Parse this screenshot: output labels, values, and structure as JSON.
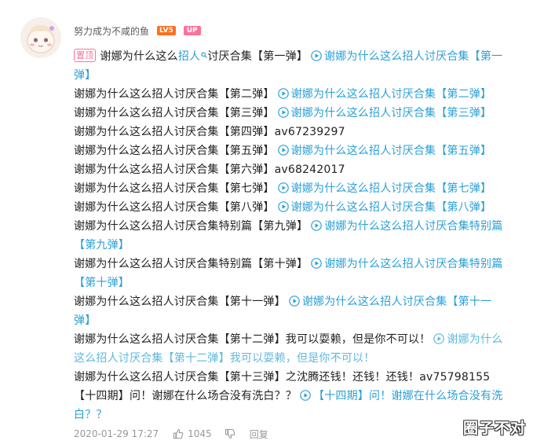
{
  "comment": {
    "username": "努力成为不咸的鱼",
    "level_badge": "LV5",
    "up_badge": "UP",
    "pin_label": "置顶",
    "keyword": "招人",
    "lines": [
      [
        "谢娜为什么这么",
        "讨厌合集【第一弹】",
        "谢娜为什么这么招人讨厌合集【第一",
        "弹】"
      ],
      [
        "谢娜为什么这么招人讨厌合集【第二弹】",
        "谢娜为什么这么招人讨厌合集【第二弹】"
      ],
      [
        "谢娜为什么这么招人讨厌合集【第三弹】",
        "谢娜为什么这么招人讨厌合集【第三弹】"
      ],
      [
        "谢娜为什么这么招人讨厌合集【第四弹】av67239297"
      ],
      [
        "谢娜为什么这么招人讨厌合集【第五弹】",
        "谢娜为什么这么招人讨厌合集【第五弹】"
      ],
      [
        "谢娜为什么这么招人讨厌合集【第六弹】av68242017"
      ],
      [
        "谢娜为什么这么招人讨厌合集【第七弹】",
        "谢娜为什么这么招人讨厌合集【第七弹】"
      ],
      [
        "谢娜为什么这么招人讨厌合集【第八弹】",
        "谢娜为什么这么招人讨厌合集【第八弹】"
      ],
      [
        "谢娜为什么这么招人讨厌合集特别篇【第九弹】",
        "谢娜为什么这么招人讨厌合集特别篇",
        "【第九弹】"
      ],
      [
        "谢娜为什么这么招人讨厌合集特别篇【第十弹】",
        "谢娜为什么这么招人讨厌合集特别篇",
        "【第十弹】"
      ],
      [
        "谢娜为什么这么招人讨厌合集【第十一弹】",
        "谢娜为什么这么招人讨厌合集【第十一",
        "弹】"
      ],
      [
        "谢娜为什么这么招人讨厌合集【第十二弹】我可以耍赖，但是你不可以！",
        "谢娜为什么",
        "这么招人讨厌合集【第十二弹】我可以耍赖，但是你不可以！"
      ],
      [
        "谢娜为什么这么招人讨厌合集【第十三弹】之沈腾还钱！还钱！还钱！av75798155"
      ],
      [
        "【十四期】问！谢娜在什么场合没有洗白？？",
        "【十四期】问！谢娜在什么场合没有洗",
        "白？？"
      ]
    ],
    "timestamp": "2020-01-29 17:27",
    "like_count": "1045",
    "reply_label": "回复"
  },
  "watermark": "圈子不对",
  "icons": [
    "avatar",
    "search-icon",
    "video-link-icon",
    "like-icon",
    "dislike-icon"
  ],
  "colors": {
    "link": "#2aa0d6",
    "pin": "#fb7299",
    "level": "#ff6f1f",
    "up": "#fb7299"
  }
}
